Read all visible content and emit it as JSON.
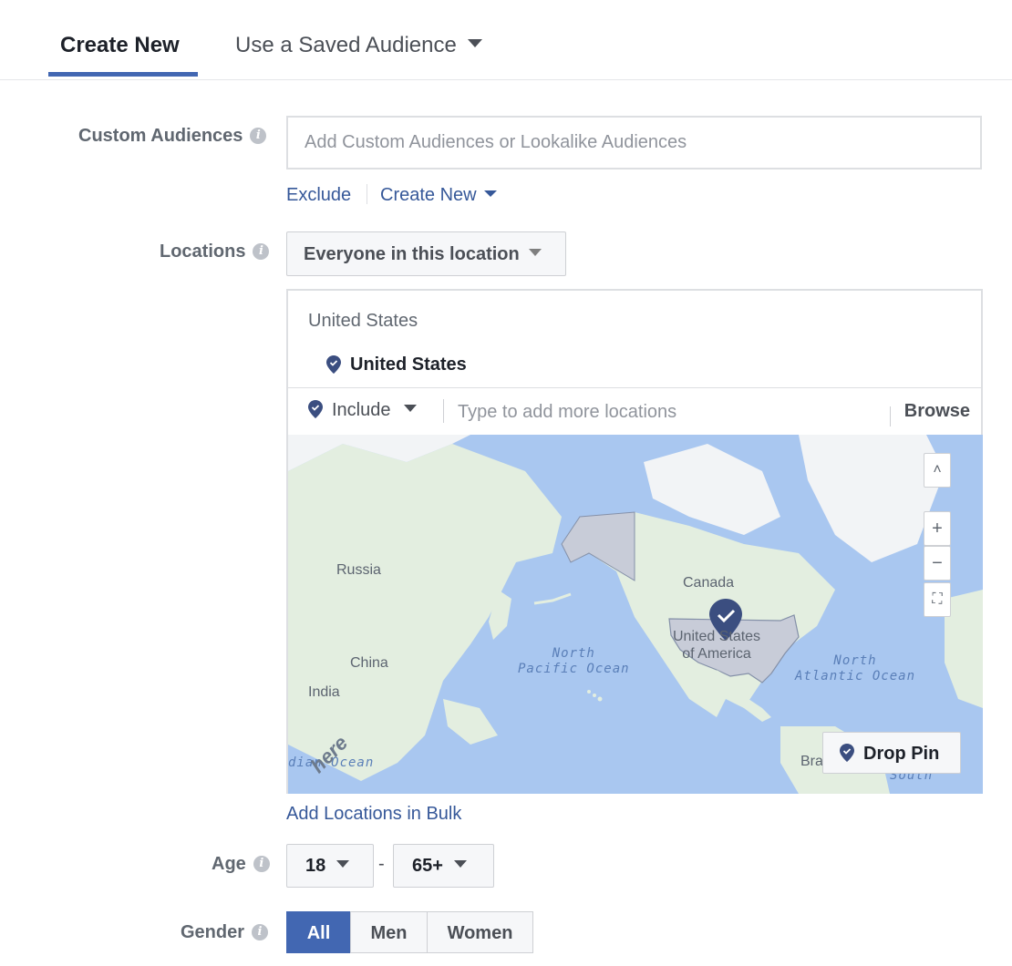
{
  "tabs": [
    {
      "label": "Create New",
      "active": true
    },
    {
      "label": "Use a Saved Audience",
      "active": false
    }
  ],
  "custom_audiences": {
    "label": "Custom Audiences",
    "placeholder": "Add Custom Audiences or Lookalike Audiences",
    "exclude_link": "Exclude",
    "create_new_link": "Create New"
  },
  "locations": {
    "label": "Locations",
    "type_dropdown": "Everyone in this location",
    "group_header": "United States",
    "selected": "United States",
    "include_label": "Include",
    "search_placeholder": "Type to add more locations",
    "browse_label": "Browse",
    "drop_pin_label": "Drop Pin",
    "bulk_link": "Add Locations in Bulk"
  },
  "map": {
    "labels": {
      "russia": "Russia",
      "canada": "Canada",
      "china": "China",
      "india": "India",
      "usa_line1": "United States",
      "usa_line2": "of America",
      "brazil": "Bra"
    },
    "oceans": {
      "north_pacific_1": "North",
      "north_pacific_2": "Pacific Ocean",
      "north_atlantic_1": "North",
      "north_atlantic_2": "Atlantic Ocean",
      "indian": "dian Ocean",
      "south": "South"
    },
    "controls": {
      "collapse": "˄",
      "zoom_in": "+",
      "zoom_out": "−",
      "fit": "⛶"
    },
    "attribution": "here",
    "colors": {
      "water": "#a9c7f0",
      "land": "#e3eee0",
      "selected": "#c8ccd8",
      "pin": "#3b4e80"
    }
  },
  "age": {
    "label": "Age",
    "min": "18",
    "separator": "-",
    "max": "65+"
  },
  "gender": {
    "label": "Gender",
    "options": [
      "All",
      "Men",
      "Women"
    ],
    "selected": "All"
  },
  "colors": {
    "accent": "#4267b2",
    "link": "#365899"
  }
}
